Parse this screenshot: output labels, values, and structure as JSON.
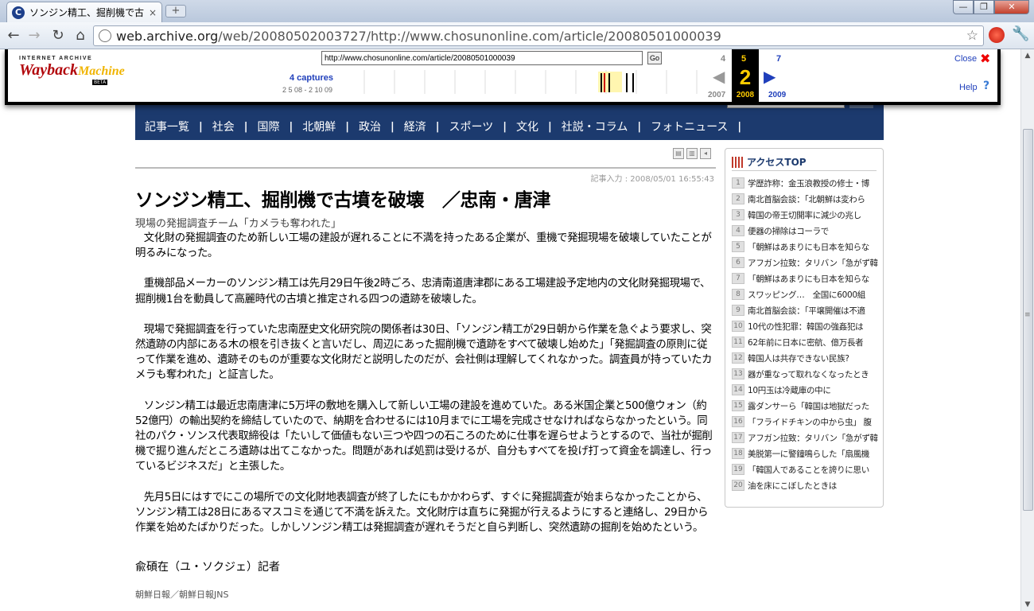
{
  "browser": {
    "tab_title": "ソンジン精工、掘削機で古",
    "tab_close": "×",
    "new_tab": "+",
    "window_buttons": {
      "minimize": "—",
      "maximize": "❐",
      "close": "✕"
    },
    "nav": {
      "back": "←",
      "forward": "→",
      "reload": "↻",
      "home": "⌂"
    },
    "url_host": "web.archive.org",
    "url_path": "/web/20080502003727/http://www.chosunonline.com/article/20080501000039",
    "star": "☆",
    "wrench": "🔧"
  },
  "wayback": {
    "logo_top": "INTERNET ARCHIVE",
    "logo_main": "Wayback",
    "logo_main2": "Machine",
    "logo_beta": "BETA",
    "url_value": "http://www.chosunonline.com/article/20080501000039",
    "go_label": "Go",
    "captures": "4 captures",
    "range": "2 5 08 - 2 10 09",
    "prev_month": "4",
    "current_month": "5",
    "current_day": "2",
    "current_year": "2008",
    "next_month": "7",
    "prev_year": "2007",
    "next_year": "2009",
    "prev_arrow": "◀",
    "next_arrow": "▶",
    "close_label": "Close",
    "close_x": "✖",
    "help_label": "Help",
    "help_q": "?",
    "colors": {
      "accent": "#1f3fbb",
      "highlight": "#ffcc00",
      "logo_red": "#b2070c"
    }
  },
  "site": {
    "nav": [
      "記事一覧",
      "社会",
      "国際",
      "北朝鮮",
      "政治",
      "経済",
      "スポーツ",
      "文化",
      "社説・コラム",
      "フォトニュース"
    ],
    "nav_sep": "|",
    "brand_color": "#1c3a6e"
  },
  "article": {
    "dateline": "記事入力 : 2008/05/01 16:55:43",
    "headline": "ソンジン精工、掘削機で古墳を破壊　／忠南・唐津",
    "subhead": "現場の発掘調査チーム「カメラも奪われた」",
    "paragraphs": [
      "文化財の発掘調査のため新しい工場の建設が遅れることに不満を持ったある企業が、重機で発掘現場を破壊していたことが明るみになった。",
      "重機部品メーカーのソンジン精工は先月29日午後2時ごろ、忠清南道唐津郡にある工場建設予定地内の文化財発掘現場で、掘削機1台を動員して高麗時代の古墳と推定される四つの遺跡を破壊した。",
      "現場で発掘調査を行っていた忠南歴史文化研究院の関係者は30日、「ソンジン精工が29日朝から作業を急ぐよう要求し、突然遺跡の内部にある木の根を引き抜くと言いだし、周辺にあった掘削機で遺跡をすべて破壊し始めた」「発掘調査の原則に従って作業を進め、遺跡そのものが重要な文化財だと説明したのだが、会社側は理解してくれなかった。調査員が持っていたカメラも奪われた」と証言した。",
      "ソンジン精工は最近忠南唐津に5万坪の敷地を購入して新しい工場の建設を進めていた。ある米国企業と500億ウォン（約52億円）の輸出契約を締結していたので、納期を合わせるには10月までに工場を完成させなければならなかったという。同社のパク・ソンス代表取締役は「たいして価値もない三つや四つの石ころのために仕事を遅らせようとするので、当社が掘削機で掘り進んだところ遺跡は出てこなかった。問題があれば処罰は受けるが、自分もすべてを投げ打って資金を調達し、行っているビジネスだ」と主張した。",
      "先月5日にはすでにこの場所での文化財地表調査が終了したにもかかわらず、すぐに発掘調査が始まらなかったことから、ソンジン精工は28日にあるマスコミを通じて不満を訴えた。文化財庁は直ちに発掘が行えるようにすると連絡し、29日から作業を始めたばかりだった。しかしソンジン精工は発掘調査が遅れそうだと自ら判断し、突然遺跡の掘削を始めたという。"
    ],
    "byline": "兪碩在（ユ・ソクジェ）記者",
    "source": "朝鮮日報／朝鮮日報JNS"
  },
  "sidebar": {
    "title": "アクセスTOP",
    "items": [
      {
        "num": "1",
        "text": "学歴詐称：金玉浪教授の修士・博"
      },
      {
        "num": "2",
        "text": "南北首脳会談：「北朝鮮は変わら"
      },
      {
        "num": "3",
        "text": "韓国の帝王切開率に減少の兆し"
      },
      {
        "num": "4",
        "text": "便器の掃除はコーラで"
      },
      {
        "num": "5",
        "text": "「朝鮮はあまりにも日本を知らな"
      },
      {
        "num": "6",
        "text": "アフガン拉致：タリバン「急がず韓"
      },
      {
        "num": "7",
        "text": "「朝鮮はあまりにも日本を知らな"
      },
      {
        "num": "8",
        "text": "スワッピング…　全国に6000組"
      },
      {
        "num": "9",
        "text": "南北首脳会談：「平壌開催は不適"
      },
      {
        "num": "10",
        "text": "10代の性犯罪：韓国の強姦犯は"
      },
      {
        "num": "11",
        "text": "62年前に日本に密航、億万長者"
      },
      {
        "num": "12",
        "text": "韓国人は共存できない民族?"
      },
      {
        "num": "13",
        "text": "器が重なって取れなくなったとき"
      },
      {
        "num": "14",
        "text": "10円玉は冷蔵庫の中に"
      },
      {
        "num": "15",
        "text": "露ダンサーら「韓国は地獄だった"
      },
      {
        "num": "16",
        "text": "「フライドチキンの中から虫」 腹"
      },
      {
        "num": "17",
        "text": "アフガン拉致：タリバン「急がず韓"
      },
      {
        "num": "18",
        "text": "美脱第一に警鐘鳴らした「扇風機"
      },
      {
        "num": "19",
        "text": "「韓国人であることを誇りに思い"
      },
      {
        "num": "20",
        "text": "油を床にこぼしたときは"
      }
    ]
  }
}
